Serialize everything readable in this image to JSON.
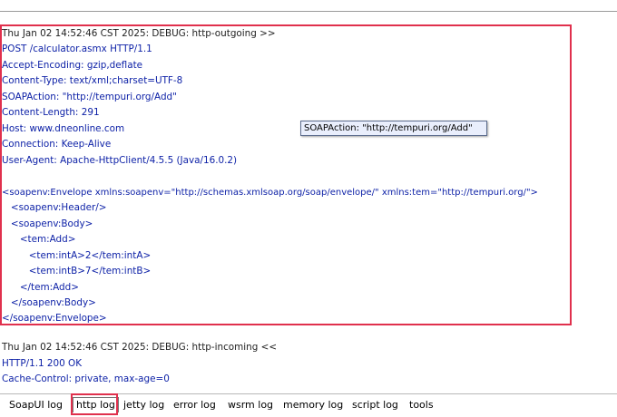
{
  "request": {
    "header_line": "Thu Jan 02 14:52:46 CST 2025: DEBUG: http-outgoing >>",
    "lines": [
      "POST /calculator.asmx HTTP/1.1",
      "Accept-Encoding: gzip,deflate",
      "Content-Type: text/xml;charset=UTF-8",
      "SOAPAction: \"http://tempuri.org/Add\"",
      "Content-Length: 291",
      "Host: www.dneonline.com",
      "Connection: Keep-Alive",
      "User-Agent: Apache-HttpClient/4.5.5 (Java/16.0.2)",
      "",
      "<soapenv:Envelope xmlns:soapenv=\"http://schemas.xmlsoap.org/soap/envelope/\" xmlns:tem=\"http://tempuri.org/\">",
      "   <soapenv:Header/>",
      "   <soapenv:Body>",
      "      <tem:Add>",
      "         <tem:intA>2</tem:intA>",
      "         <tem:intB>7</tem:intB>",
      "      </tem:Add>",
      "   </soapenv:Body>",
      "</soapenv:Envelope>"
    ]
  },
  "tooltip": {
    "text": "SOAPAction: \"http://tempuri.org/Add\""
  },
  "response": {
    "header_line": "Thu Jan 02 14:52:46 CST 2025: DEBUG: http-incoming <<",
    "status_line": "HTTP/1.1 200 OK",
    "partial_line": "Cache-Control: private, max-age=0"
  },
  "tabs": [
    {
      "label": "SoapUI log"
    },
    {
      "label": "http log"
    },
    {
      "label": "jetty log"
    },
    {
      "label": "error log"
    },
    {
      "label": "wsrm log"
    },
    {
      "label": "memory log"
    },
    {
      "label": "script log"
    },
    {
      "label": "tools"
    }
  ],
  "active_tab": "http log",
  "colors": {
    "request_text": "#0b1fa6",
    "highlight": "#e0304d"
  }
}
